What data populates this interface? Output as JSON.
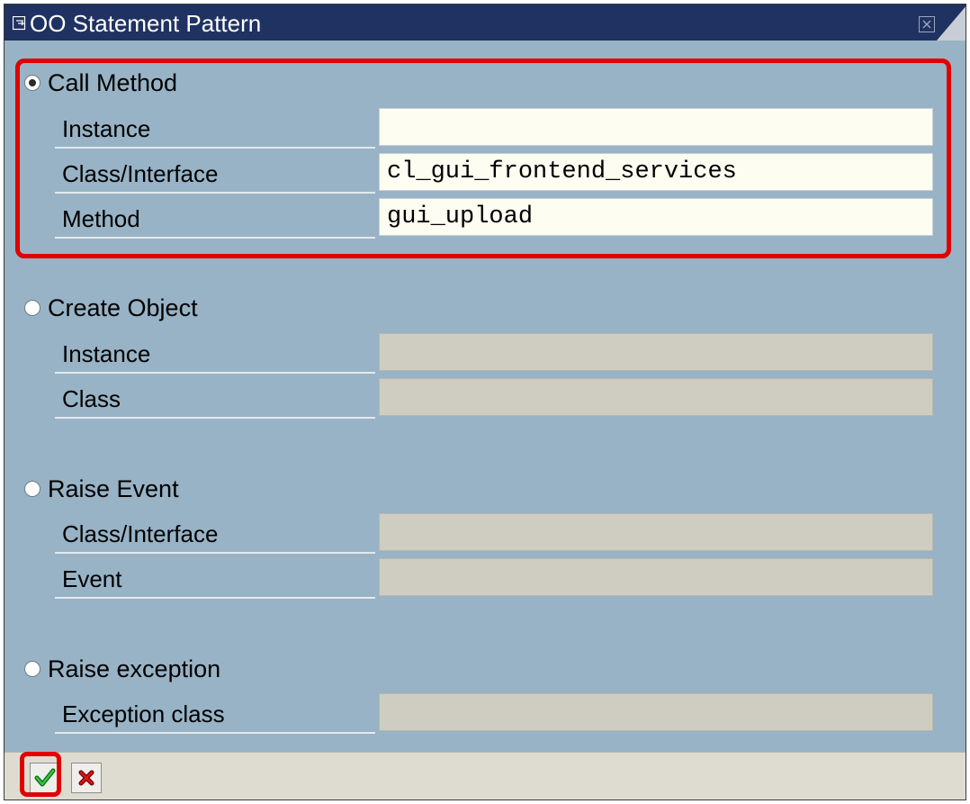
{
  "window": {
    "title": "OO Statement Pattern"
  },
  "sections": [
    {
      "label": "Call Method",
      "selected": true,
      "fields": [
        {
          "label": "Instance",
          "value": ""
        },
        {
          "label": "Class/Interface",
          "value": "cl_gui_frontend_services"
        },
        {
          "label": "Method",
          "value": "gui_upload"
        }
      ]
    },
    {
      "label": "Create Object",
      "selected": false,
      "fields": [
        {
          "label": "Instance",
          "value": ""
        },
        {
          "label": "Class",
          "value": ""
        }
      ]
    },
    {
      "label": "Raise Event",
      "selected": false,
      "fields": [
        {
          "label": "Class/Interface",
          "value": ""
        },
        {
          "label": "Event",
          "value": ""
        }
      ]
    },
    {
      "label": "Raise exception",
      "selected": false,
      "fields": [
        {
          "label": "Exception class",
          "value": ""
        }
      ]
    }
  ],
  "toolbar": {
    "confirm_icon": "checkmark-icon",
    "cancel_icon": "cancel-x-icon"
  },
  "colors": {
    "background": "#98b3c5",
    "titlebar": "#1f3262",
    "highlight": "#e00000",
    "input_active": "#fefdf2",
    "input_disabled": "#cfccc1"
  }
}
